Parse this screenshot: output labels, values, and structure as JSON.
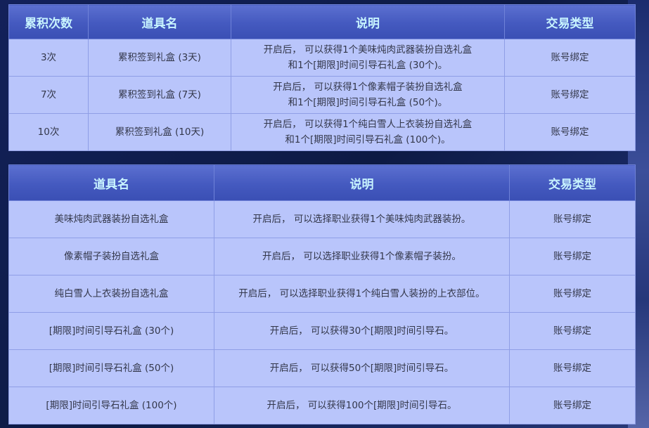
{
  "table1": {
    "headers": [
      "累积次数",
      "道具名",
      "说明",
      "交易类型"
    ],
    "rows": [
      {
        "count": "3次",
        "item": "累积签到礼盒 (3天)",
        "desc1": "开启后， 可以获得1个美味炖肉武器装扮自选礼盒",
        "desc2": "和1个[期限]时间引导石礼盒 (30个)。",
        "trade": "账号绑定"
      },
      {
        "count": "7次",
        "item": "累积签到礼盒 (7天)",
        "desc1": "开启后， 可以获得1个像素帽子装扮自选礼盒",
        "desc2": "和1个[期限]时间引导石礼盒 (50个)。",
        "trade": "账号绑定"
      },
      {
        "count": "10次",
        "item": "累积签到礼盒 (10天)",
        "desc1": "开启后， 可以获得1个纯白雪人上衣装扮自选礼盒",
        "desc2": "和1个[期限]时间引导石礼盒 (100个)。",
        "trade": "账号绑定"
      }
    ]
  },
  "table2": {
    "headers": [
      "道具名",
      "说明",
      "交易类型"
    ],
    "rows": [
      {
        "item": "美味炖肉武器装扮自选礼盒",
        "desc": "开启后， 可以选择职业获得1个美味炖肉武器装扮。",
        "trade": "账号绑定"
      },
      {
        "item": "像素帽子装扮自选礼盒",
        "desc": "开启后， 可以选择职业获得1个像素帽子装扮。",
        "trade": "账号绑定"
      },
      {
        "item": "纯白雪人上衣装扮自选礼盒",
        "desc": "开启后， 可以选择职业获得1个纯白雪人装扮的上衣部位。",
        "trade": "账号绑定"
      },
      {
        "item": "[期限]时间引导石礼盒 (30个)",
        "desc": "开启后， 可以获得30个[期限]时间引导石。",
        "trade": "账号绑定"
      },
      {
        "item": "[期限]时间引导石礼盒 (50个)",
        "desc": "开启后， 可以获得50个[期限]时间引导石。",
        "trade": "账号绑定"
      },
      {
        "item": "[期限]时间引导石礼盒 (100个)",
        "desc": "开启后， 可以获得100个[期限]时间引导石。",
        "trade": "账号绑定"
      }
    ]
  }
}
